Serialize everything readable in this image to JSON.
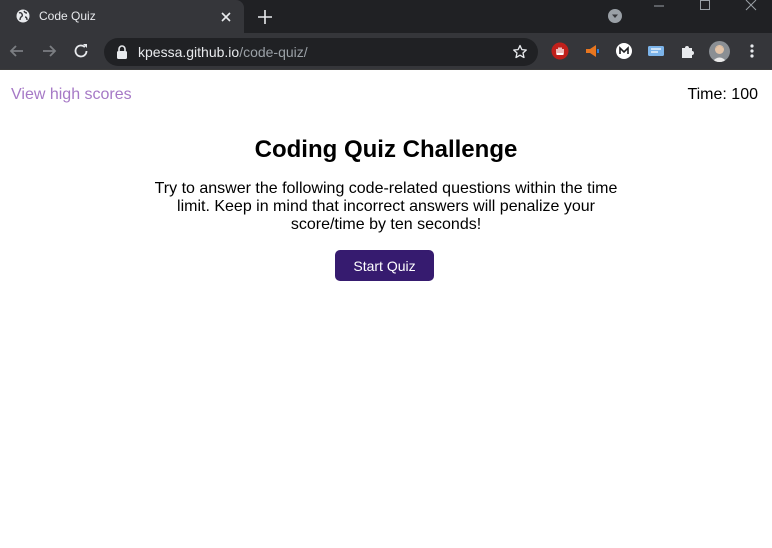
{
  "browser": {
    "tab_title": "Code Quiz",
    "url_host": "kpessa.github.io",
    "url_path": "/code-quiz/",
    "colors": {
      "tabstrip": "#202124",
      "toolbar": "#35363a",
      "omnibox": "#202124"
    },
    "icons": [
      "globe-icon",
      "close-icon",
      "plus-icon",
      "chevron-down-icon",
      "minimize-icon",
      "maximize-icon",
      "window-close-icon",
      "back-arrow-icon",
      "forward-arrow-icon",
      "reload-icon",
      "lock-icon",
      "star-icon",
      "extension-stop-icon",
      "extension-megaphone-icon",
      "extension-m-icon",
      "extension-bookmark-icon",
      "puzzle-icon",
      "avatar",
      "kebab-menu-icon"
    ]
  },
  "page": {
    "highscores_link": "View high scores",
    "timer_label": "Time:",
    "timer_value": "100",
    "title": "Coding Quiz Challenge",
    "intro": "Try to answer the following code-related questions within the time limit. Keep in mind that incorrect answers will penalize your score/time by ten seconds!",
    "start_button": "Start Quiz",
    "colors": {
      "link": "#a679c6",
      "button": "#361b6f",
      "button_text": "#ffffff"
    }
  }
}
